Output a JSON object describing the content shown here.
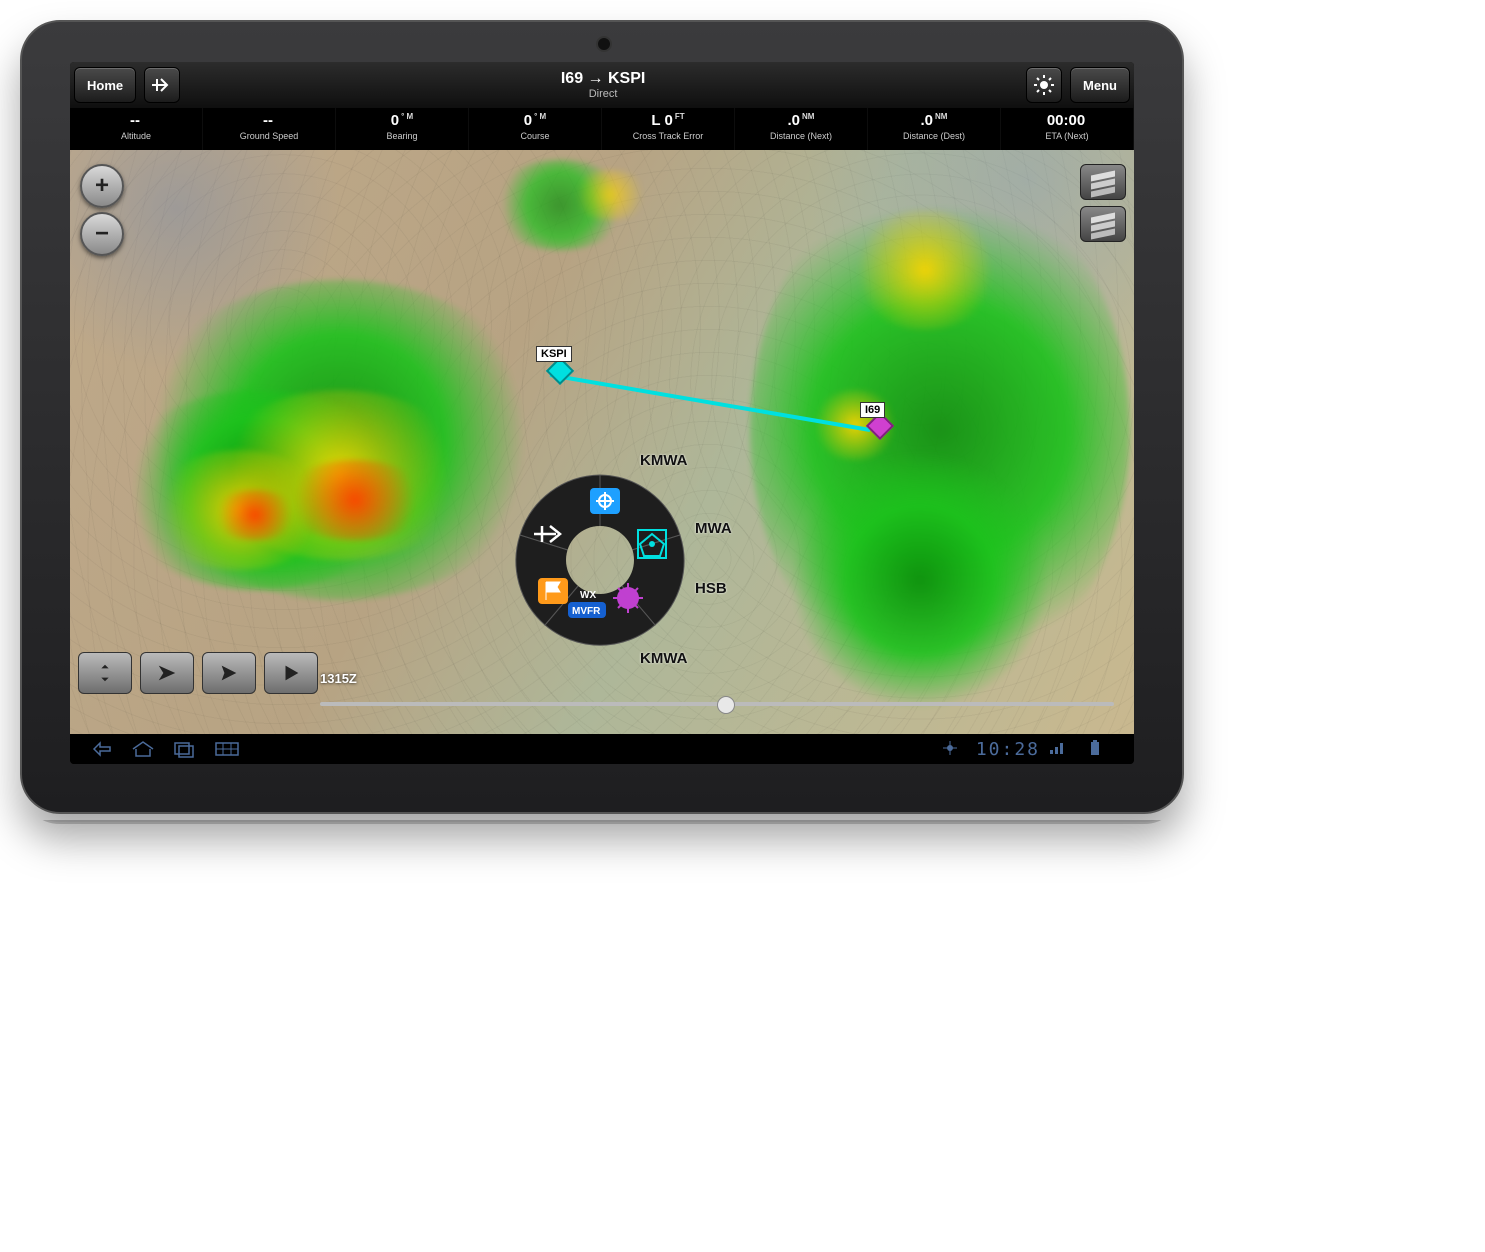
{
  "header": {
    "home": "Home",
    "menu": "Menu",
    "route": "I69 → KSPI",
    "route_sub": "Direct"
  },
  "strip": [
    {
      "val": "--",
      "unit": "",
      "lbl": "Altitude"
    },
    {
      "val": "--",
      "unit": "",
      "lbl": "Ground Speed"
    },
    {
      "val": "0",
      "unit": "° M",
      "lbl": "Bearing"
    },
    {
      "val": "0",
      "unit": "° M",
      "lbl": "Course"
    },
    {
      "val": "L 0",
      "unit": "FT",
      "lbl": "Cross Track Error"
    },
    {
      "val": ".0",
      "unit": "NM",
      "lbl": "Distance (Next)"
    },
    {
      "val": ".0",
      "unit": "NM",
      "lbl": "Distance (Dest)"
    },
    {
      "val": "00:00",
      "unit": "",
      "lbl": "ETA (Next)"
    }
  ],
  "waypoints": {
    "dest": "KSPI",
    "origin": "I69"
  },
  "radial": {
    "labels": [
      "KMWA",
      "MWA",
      "HSB",
      "KMWA"
    ],
    "wx_label": "WX",
    "wx_badge": "MVFR"
  },
  "timestamp": "1315Z",
  "system": {
    "clock": "10:28"
  }
}
